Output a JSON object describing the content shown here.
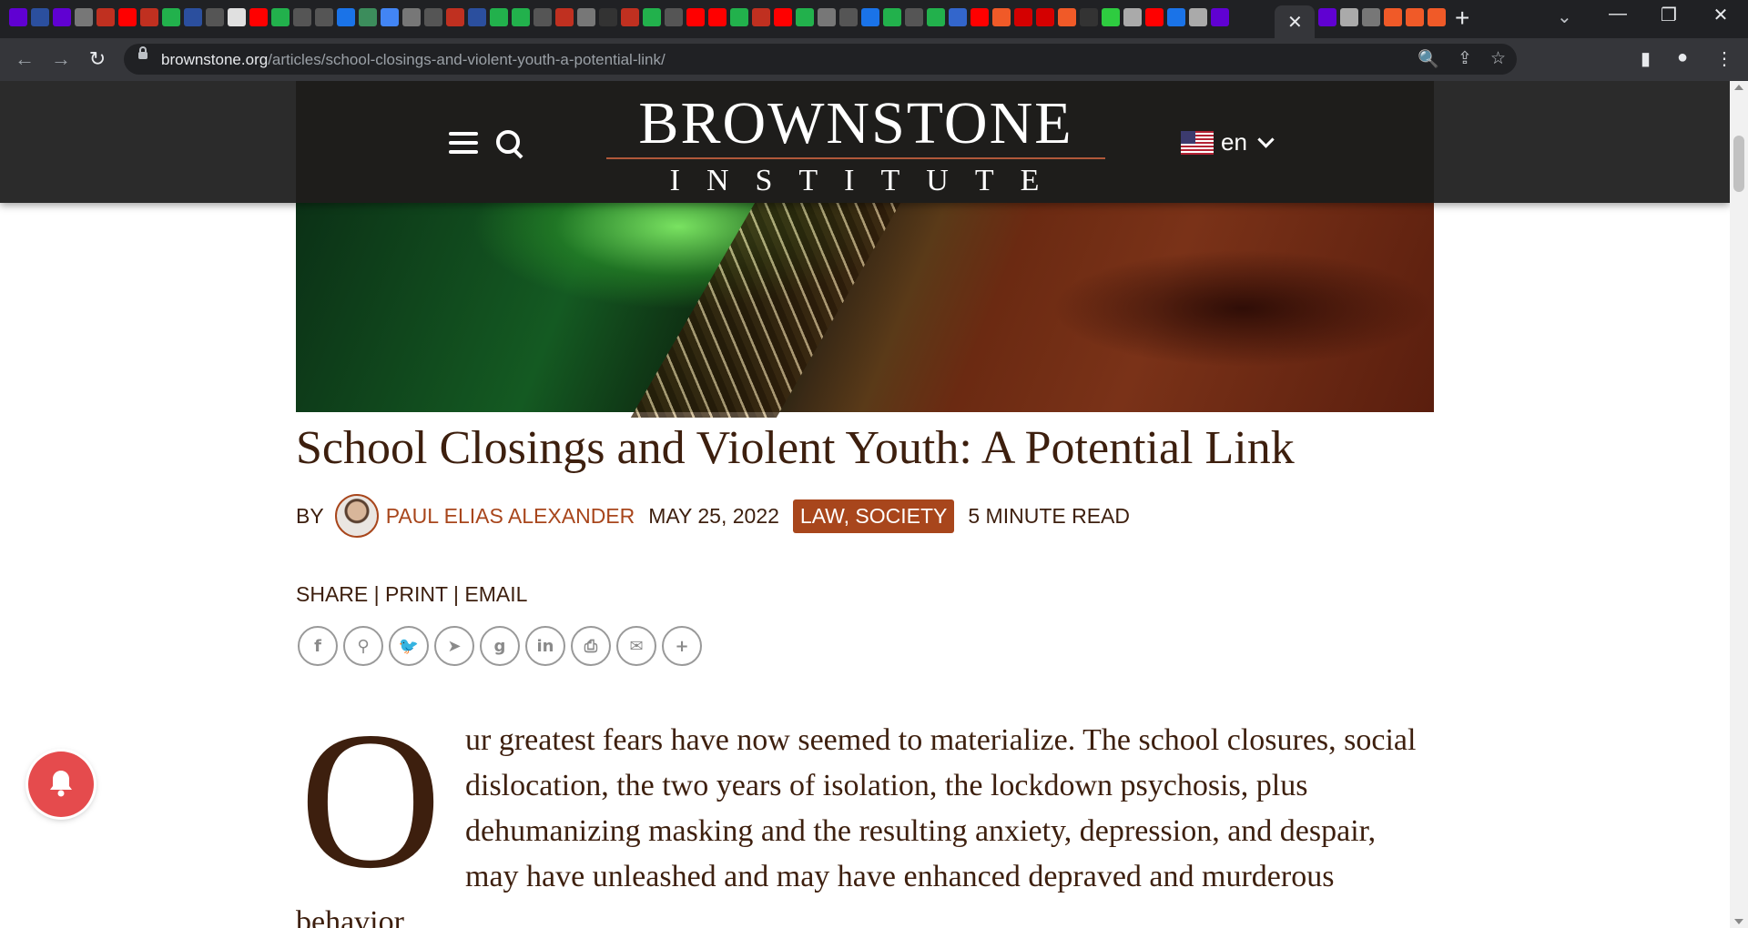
{
  "browser": {
    "tab_favicon_colors": [
      "#6001d2",
      "#2b4f9e",
      "#6001d2",
      "#777777",
      "#c03020",
      "#ff0000",
      "#c03020",
      "#22b14c",
      "#2b4f9e",
      "#555555",
      "#e0e0e0",
      "#ff0000",
      "#22b14c",
      "#555555",
      "#555555",
      "#1a73e8",
      "#3c8d5c",
      "#4285f4",
      "#777777",
      "#555555",
      "#c03020",
      "#2b4f9e",
      "#22b14c",
      "#22b14c",
      "#555555",
      "#c03020",
      "#777777",
      "#333333",
      "#c03020",
      "#22b14c",
      "#555555",
      "#ff0000",
      "#ff0000",
      "#22b14c",
      "#c03020",
      "#ff0000",
      "#22b14c",
      "#777777",
      "#555555",
      "#1a73e8",
      "#22b14c",
      "#555555",
      "#22b14c",
      "#3366cc",
      "#ff0000",
      "#f05a28",
      "#d40000",
      "#d40000",
      "#f05a28",
      "#333333",
      "#2ecc40",
      "#aaaaaa",
      "#ff0000",
      "#1a73e8",
      "#aaaaaa",
      "#6001d2"
    ],
    "tab_favicon_colors_after": [
      "#6001d2",
      "#aaaaaa",
      "#777777",
      "#f05a28",
      "#f05a28",
      "#f05a28"
    ],
    "active_tab_close": "✕",
    "new_tab_label": "+",
    "window_controls": {
      "minimize": "—",
      "restore": "❐",
      "close": "✕",
      "tab_list": "⌄"
    },
    "nav": {
      "back": "←",
      "forward": "→",
      "reload": "↻"
    },
    "url_host": "brownstone.org",
    "url_path": "/articles/school-closings-and-violent-youth-a-potential-link/",
    "omnibox_icons": {
      "zoom": "🔍",
      "share": "⇪",
      "bookmark": "☆"
    },
    "toolbar_icons": {
      "side_panel": "▮",
      "profile": "●",
      "menu": "⋮"
    }
  },
  "header": {
    "logo_top": "BROWNSTONE",
    "logo_bottom": "INSTITUTE",
    "language": "en"
  },
  "article": {
    "title": "School Closings and Violent Youth: A Potential Link",
    "by_label": "BY",
    "author": "PAUL ELIAS ALEXANDER",
    "date": "MAY 25, 2022",
    "tags": "LAW, SOCIETY",
    "read_time": "5 MINUTE READ",
    "share_label": "SHARE",
    "print_label": "PRINT",
    "email_label": "EMAIL",
    "share_icons": [
      {
        "name": "facebook-icon",
        "glyph": "f"
      },
      {
        "name": "gettr-icon",
        "glyph": "⚲"
      },
      {
        "name": "twitter-icon",
        "glyph": "🐦"
      },
      {
        "name": "telegram-icon",
        "glyph": "➤"
      },
      {
        "name": "gab-icon",
        "glyph": "g"
      },
      {
        "name": "linkedin-icon",
        "glyph": "in"
      },
      {
        "name": "print-icon",
        "glyph": "⎙"
      },
      {
        "name": "email-icon",
        "glyph": "✉"
      },
      {
        "name": "more-icon",
        "glyph": "+"
      }
    ],
    "drop_cap": "O",
    "body_text": "ur greatest fears have now seemed to materialize. The school closures, social dislocation, the two years of isolation, the lockdown psychosis, plus dehumanizing masking and the resulting anxiety, depression, and despair, may have unleashed and may have enhanced depraved and murderous behavior."
  },
  "colors": {
    "accent": "#a8461c",
    "text": "#3d1f0e",
    "header_bg": "#2b2b2b",
    "notify": "#e54b4d"
  }
}
